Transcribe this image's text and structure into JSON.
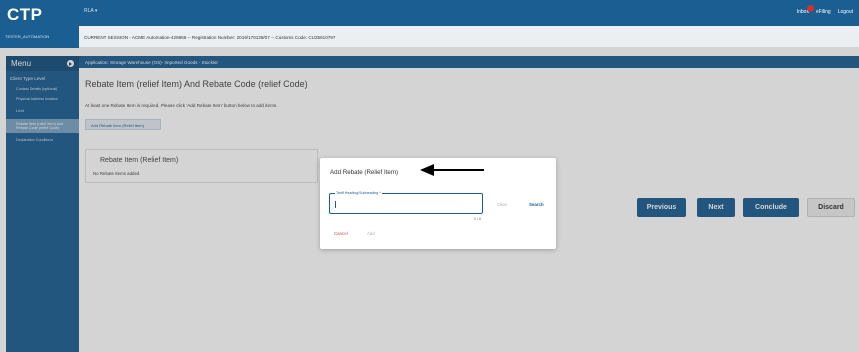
{
  "header": {
    "logo": "CTP",
    "user_menu": "RLA ▾",
    "inbox_label": "Inbox",
    "links": [
      "eFiling",
      "Logout"
    ],
    "tester": "TESTER_AUTOMATION",
    "session": "CURRENT SESSION - ACME Automation-426686 -- Registration Number: 2019/170139/07 -- Customs Code: CU25810797"
  },
  "appbar": {
    "text": "Application: Storage Warehouse (OS)- Imported Goods - Stockist"
  },
  "sidebar": {
    "menu_label": "Menu",
    "level_label": "Client Type Level",
    "items": [
      {
        "label": "Contact Details (optional)",
        "active": false
      },
      {
        "label": "Physical Address location",
        "active": false
      },
      {
        "label": "Limit",
        "active": false
      },
      {
        "label": "Rebate Item (relief Item) And Rebate Code (relief Code)",
        "active": true
      },
      {
        "label": "Declaration Conditions",
        "active": false
      }
    ]
  },
  "main": {
    "title": "Rebate Item (relief Item) And Rebate Code (relief Code)",
    "info": "At least one Rebate Item is required. Please click 'Add Rebate Item' button below to add items.",
    "add_button": "Add Rebate Item (Relief Item)",
    "card_title": "Rebate Item (Relief Item)",
    "card_empty": "No Rebate Items added"
  },
  "actions": {
    "previous": "Previous",
    "next": "Next",
    "conclude": "Conclude",
    "discard": "Discard"
  },
  "modal": {
    "title": "Add Rebate (Relief Item)",
    "field_label": "Tariff Heading/Subheading *",
    "field_value": "",
    "counter": "0 / 8",
    "clear": "Clear",
    "search": "Search",
    "cancel": "Cancel",
    "add": "Add"
  },
  "colors": {
    "primary": "#1b5e91",
    "cancel": "#d24c4c",
    "badge": "#d32f2f"
  }
}
